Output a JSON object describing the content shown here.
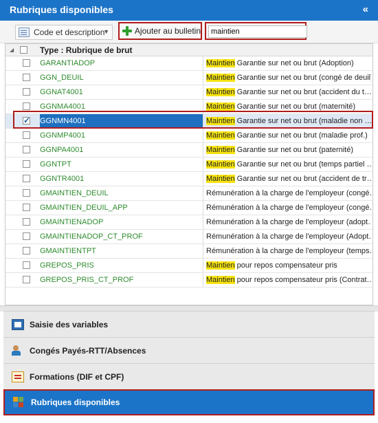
{
  "header": {
    "title": "Rubriques disponibles",
    "collapse_glyph": "«"
  },
  "toolbar": {
    "view_label": "Code et description",
    "add_label": "Ajouter au bulletin",
    "search_value": "maintien"
  },
  "grid": {
    "column_header": "Type : Rubrique de brut",
    "rows": [
      {
        "code": "GARANTIADOP",
        "hl": "Maintien",
        "desc": " Garantie sur net ou brut (Adoption)",
        "checked": false
      },
      {
        "code": "GGN_DEUIL",
        "hl": "Maintien",
        "desc": " Garantie sur net ou brut (congé de deuil)",
        "checked": false
      },
      {
        "code": "GGNAT4001",
        "hl": "Maintien",
        "desc": " Garantie sur net ou brut (accident du t…",
        "checked": false
      },
      {
        "code": "GGNMA4001",
        "hl": "Maintien",
        "desc": " Garantie sur net ou brut (maternité)",
        "checked": false
      },
      {
        "code": "GGNMN4001",
        "hl": "Maintien",
        "desc": " Garantie sur net ou brut (maladie non …",
        "checked": true
      },
      {
        "code": "GGNMP4001",
        "hl": "Maintien",
        "desc": " Garantie sur net ou brut (maladie prof.)",
        "checked": false
      },
      {
        "code": "GGNPA4001",
        "hl": "Maintien",
        "desc": " Garantie sur net ou brut (paternité)",
        "checked": false
      },
      {
        "code": "GGNTPT",
        "hl": "Maintien",
        "desc": " Garantie sur net ou brut (temps partiel …",
        "checked": false
      },
      {
        "code": "GGNTR4001",
        "hl": "Maintien",
        "desc": " Garantie sur net ou brut (accident de tr…",
        "checked": false
      },
      {
        "code": "GMAINTIEN_DEUIL",
        "hl": "",
        "desc": "Rémunération à la charge de l'employeur (congé…",
        "checked": false
      },
      {
        "code": "GMAINTIEN_DEUIL_APP",
        "hl": "",
        "desc": "Rémunération à la charge de l'employeur (congé…",
        "checked": false
      },
      {
        "code": "GMAINTIENADOP",
        "hl": "",
        "desc": "Rémunération à la charge de l'employeur (adopt…",
        "checked": false
      },
      {
        "code": "GMAINTIENADOP_CT_PROF",
        "hl": "",
        "desc": "Rémunération à la charge de l'employeur (Adopt…",
        "checked": false
      },
      {
        "code": "GMAINTIENTPT",
        "hl": "",
        "desc": "Rémunération à la charge de l'employeur (temps…",
        "checked": false
      },
      {
        "code": "GREPOS_PRIS",
        "hl": "Maintien",
        "desc": " pour repos compensateur pris",
        "checked": false
      },
      {
        "code": "GREPOS_PRIS_CT_PROF",
        "hl": "Maintien",
        "desc": " pour repos compensateur pris (Contrat…",
        "checked": false
      }
    ]
  },
  "nav": {
    "items": [
      {
        "label": "Saisie des variables",
        "icon": "variables-icon"
      },
      {
        "label": "Congés Payés-RTT/Absences",
        "icon": "person-icon"
      },
      {
        "label": "Formations (DIF et CPF)",
        "icon": "certificate-icon"
      },
      {
        "label": "Rubriques disponibles",
        "icon": "grid-icon",
        "active": true
      }
    ]
  },
  "colors": {
    "accent": "#1c74c8",
    "highlight": "#f6e311",
    "code_text": "#2e8b2e",
    "annotation_red": "#b11b1b"
  }
}
